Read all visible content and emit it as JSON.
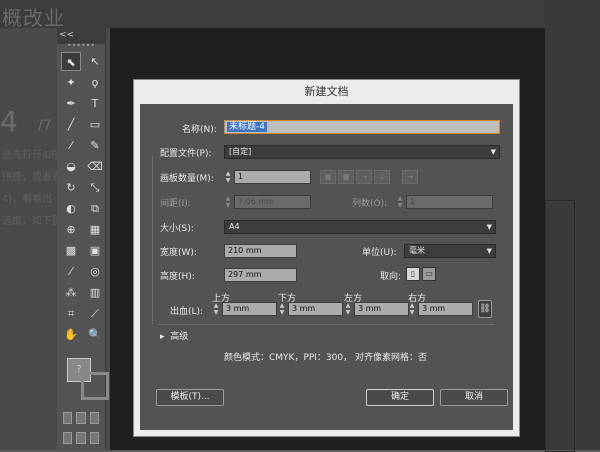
{
  "background": {
    "doc_title_fragment": "概改业",
    "big_number": "4",
    "page_fraction": "/7",
    "behind_lines": [
      "选先打开4的",
      "拼捷，或者直",
      "4)，看看出",
      "选框，如下图"
    ]
  },
  "toolbar": {
    "collapse_label": "<<",
    "grip": "••••••",
    "tools": [
      {
        "name": "selection-tool",
        "glyph": "⬉"
      },
      {
        "name": "direct-selection-tool",
        "glyph": "↖"
      },
      {
        "name": "magic-wand-tool",
        "glyph": "✦"
      },
      {
        "name": "lasso-tool",
        "glyph": "ϙ"
      },
      {
        "name": "pen-tool",
        "glyph": "✒"
      },
      {
        "name": "type-tool",
        "glyph": "T"
      },
      {
        "name": "line-tool",
        "glyph": "╱"
      },
      {
        "name": "rectangle-tool",
        "glyph": "▭"
      },
      {
        "name": "paintbrush-tool",
        "glyph": "⁄"
      },
      {
        "name": "pencil-tool",
        "glyph": "✎"
      },
      {
        "name": "blob-brush-tool",
        "glyph": "◒"
      },
      {
        "name": "eraser-tool",
        "glyph": "⌫"
      },
      {
        "name": "rotate-tool",
        "glyph": "↻"
      },
      {
        "name": "scale-tool",
        "glyph": "⤡"
      },
      {
        "name": "warp-tool",
        "glyph": "◐"
      },
      {
        "name": "free-transform-tool",
        "glyph": "⧉"
      },
      {
        "name": "shape-builder-tool",
        "glyph": "⊕"
      },
      {
        "name": "perspective-grid-tool",
        "glyph": "▦"
      },
      {
        "name": "mesh-tool",
        "glyph": "▩"
      },
      {
        "name": "gradient-tool",
        "glyph": "▣"
      },
      {
        "name": "eyedropper-tool",
        "glyph": "⁄"
      },
      {
        "name": "blend-tool",
        "glyph": "◎"
      },
      {
        "name": "symbol-sprayer-tool",
        "glyph": "⁂"
      },
      {
        "name": "column-graph-tool",
        "glyph": "▥"
      },
      {
        "name": "artboard-tool",
        "glyph": "⌗"
      },
      {
        "name": "slice-tool",
        "glyph": "⟋"
      },
      {
        "name": "hand-tool",
        "glyph": "✋"
      },
      {
        "name": "zoom-tool",
        "glyph": "🔍"
      }
    ],
    "swatch_glyph": "?"
  },
  "dialog": {
    "title": "新建文档",
    "name_label": "名称(N):",
    "name_value": "未标题-4",
    "profile_label": "配置文件(P):",
    "profile_value": "[自定]",
    "artboards_label": "画板数量(M):",
    "artboards_value": "1",
    "arrow_glyph": "→",
    "spacing_label": "间距(I):",
    "spacing_value": "7.06 mm",
    "columns_label": "列数(O):",
    "columns_value": "1",
    "size_label": "大小(S):",
    "size_value": "A4",
    "width_label": "宽度(W):",
    "width_value": "210 mm",
    "units_label": "单位(U):",
    "units_value": "毫米",
    "height_label": "高度(H):",
    "height_value": "297 mm",
    "orientation_label": "取向:",
    "bleed_label": "出血(L):",
    "bleed_top_label": "上方",
    "bleed_top_value": "3 mm",
    "bleed_bottom_label": "下方",
    "bleed_bottom_value": "3 mm",
    "bleed_left_label": "左方",
    "bleed_left_value": "3 mm",
    "bleed_right_label": "右方",
    "bleed_right_value": "3 mm",
    "advanced_label": "高级",
    "info_text": "颜色模式：CMYK，PPI：300， 对齐像素网格：否",
    "templates_button": "模板(T)...",
    "ok_button": "确定",
    "cancel_button": "取消"
  }
}
